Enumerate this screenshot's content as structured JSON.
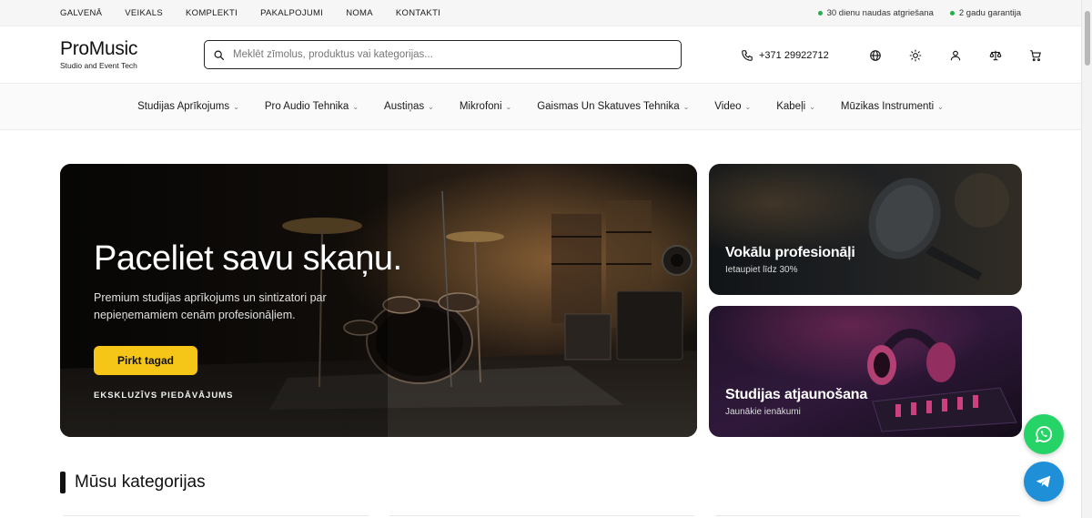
{
  "topbar": {
    "nav": [
      "GALVENĀ",
      "VEIKALS",
      "KOMPLEKTI",
      "PAKALPOJUMI",
      "NOMA",
      "KONTAKTI"
    ],
    "perks": [
      "30 dienu naudas atgriešana",
      "2 gadu garantija"
    ],
    "perk_dot_color": "#22b14c"
  },
  "header": {
    "logo_name": "ProMusic",
    "logo_sub": "Studio and Event Tech",
    "search_placeholder": "Meklēt zīmolus, produktus vai kategorijas...",
    "phone": "+371 29922712",
    "icons": [
      "phone-icon",
      "globe-icon",
      "theme-icon",
      "user-icon",
      "compare-icon",
      "cart-icon"
    ]
  },
  "categories_nav": [
    "Studijas Aprīkojums",
    "Pro Audio Tehnika",
    "Austiņas",
    "Mikrofoni",
    "Gaismas Un Skatuves Tehnika",
    "Video",
    "Kabeļi",
    "Mūzikas Instrumenti"
  ],
  "hero": {
    "eyebrow": "EKSKLUZĪVS PIEDĀVĀJUMS",
    "title": "Paceliet savu skaņu.",
    "description": "Premium studijas aprīkojums un sintizatori par nepieņemamiem cenām profesionāļiem.",
    "button": "Pirkt tagad",
    "button_color": "#f5c518"
  },
  "promos": [
    {
      "title": "Vokālu profesionāļi",
      "subtitle": "Ietaupiet līdz 30%"
    },
    {
      "title": "Studijas atjaunošana",
      "subtitle": "Jaunākie ienākumi"
    }
  ],
  "section": {
    "title": "Mūsu kategorijas"
  },
  "floating": {
    "whatsapp_color": "#25d366",
    "telegram_color": "#1f8fd8"
  }
}
